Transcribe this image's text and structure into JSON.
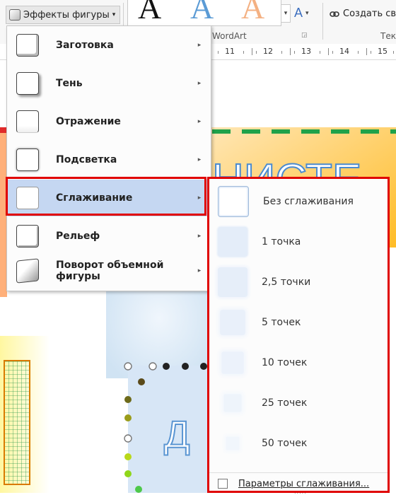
{
  "ribbon": {
    "shape_effects_label": "Эффекты фигуры",
    "shape_effects_caret": "▾",
    "wordart_samples": [
      "A",
      "A",
      "A"
    ],
    "wordart_sample_colors": [
      "#111111",
      "#5b9bd5",
      "#f4b183"
    ],
    "gallery_spin": "▾",
    "text_fill_glyph": "A",
    "text_fill_caret": "▾",
    "create_link_label": "Создать св",
    "create_link_icon": "link-icon",
    "group_wordart": "WordArt",
    "group_expand": "◲",
    "group_text": "Тек"
  },
  "ruler": {
    "labels": [
      "11",
      "12",
      "13",
      "14",
      "15"
    ]
  },
  "menu": {
    "items": [
      {
        "label": "Заготовка",
        "arrow": "▸"
      },
      {
        "label": "Тень",
        "arrow": "▸"
      },
      {
        "label": "Отражение",
        "arrow": "▸"
      },
      {
        "label": "Подсветка",
        "arrow": "▸"
      },
      {
        "label": "Сглаживание",
        "arrow": "▸"
      },
      {
        "label": "Рельеф",
        "arrow": "▸"
      },
      {
        "label": "Поворот объемной фигуры",
        "arrow": "▸"
      }
    ],
    "selected_index": 4
  },
  "submenu": {
    "items": [
      {
        "label": "Без сглаживания",
        "blur": "none"
      },
      {
        "label": "1 точка",
        "blur": "1"
      },
      {
        "label": "2,5 точки",
        "blur": "2.5"
      },
      {
        "label": "5 точек",
        "blur": "5"
      },
      {
        "label": "10 точек",
        "blur": "10"
      },
      {
        "label": "25 точек",
        "blur": "25"
      },
      {
        "label": "50 точек",
        "blur": "50"
      }
    ],
    "footer_label": "Параметры сглаживания...",
    "grip": "....."
  },
  "highlight_color": "#e00000",
  "selected_color": "#c5d7f2"
}
